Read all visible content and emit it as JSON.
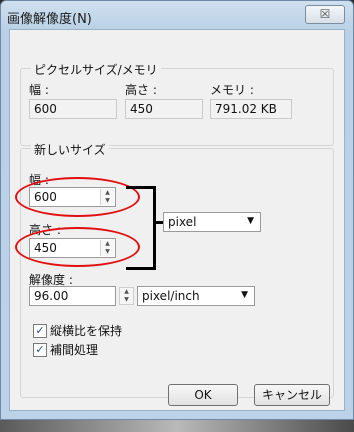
{
  "window": {
    "title": "画像解像度(N)",
    "close_glyph": "☒"
  },
  "pixel_group": {
    "label": "ピクセルサイズ/メモリ",
    "width_label": "幅 :",
    "height_label": "高さ :",
    "memory_label": "メモリ :",
    "width_value": "600",
    "height_value": "450",
    "memory_value": "791.02 KB"
  },
  "new_size_group": {
    "label": "新しいサイズ",
    "width_label": "幅 :",
    "width_value": "600",
    "height_label": "高さ :",
    "height_value": "450",
    "unit_select": "pixel",
    "resolution_label": "解像度 :",
    "resolution_value": "96.00",
    "resolution_unit": "pixel/inch",
    "keep_aspect_label": "縦横比を保持",
    "interpolate_label": "補間処理"
  },
  "buttons": {
    "ok": "OK",
    "cancel": "キャンセル"
  },
  "colors": {
    "annotation": "#e01010"
  }
}
